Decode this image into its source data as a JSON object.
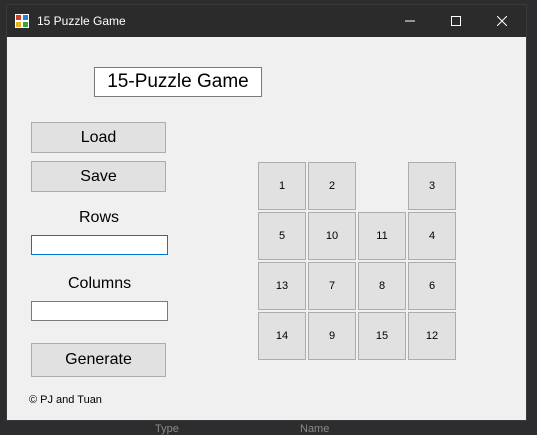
{
  "window": {
    "title": "15 Puzzle Game",
    "controls": {
      "minimize": "minimize-icon",
      "maximize": "maximize-icon",
      "close": "close-icon"
    }
  },
  "header": {
    "game_title": "15-Puzzle Game"
  },
  "controls": {
    "load_label": "Load",
    "save_label": "Save",
    "rows_label": "Rows",
    "rows_value": "",
    "columns_label": "Columns",
    "columns_value": "",
    "generate_label": "Generate"
  },
  "credits": "© PJ and Tuan",
  "board": {
    "rows": 4,
    "columns": 4,
    "tiles": [
      [
        "1",
        "2",
        "",
        "3"
      ],
      [
        "5",
        "10",
        "11",
        "4"
      ],
      [
        "13",
        "7",
        "8",
        "6"
      ],
      [
        "14",
        "9",
        "15",
        "12"
      ]
    ]
  },
  "background_panel": {
    "left_text": "Type",
    "right_text": "Name"
  },
  "colors": {
    "titlebar": "#2b2b2b",
    "window_bg": "#f0f0f0",
    "tile_bg": "#e1e1e1",
    "input_focus_border": "#0078d7"
  }
}
